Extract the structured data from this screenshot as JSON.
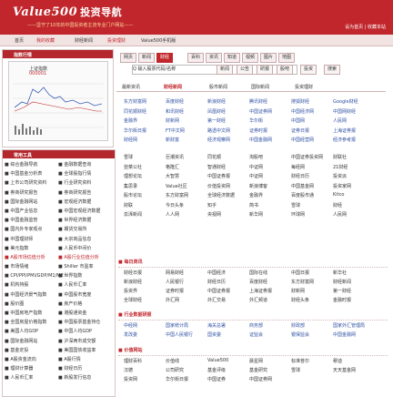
{
  "header": {
    "logo": "Value500",
    "logo_cn": "投资导航",
    "slogan": "——坚守了10年的中国投资者主流专业门户网站——",
    "right": "设为首页 | 收藏本站"
  },
  "subnav": [
    "首页",
    "我的收藏",
    "财经新闻",
    "投资理财",
    "Value500手机版"
  ],
  "left": {
    "hot_title": "指数行情",
    "chart": {
      "title": "上证指数",
      "subtitle": "000001",
      "badge": "+"
    },
    "tree_title": "常用工具",
    "tree": [
      {
        "a": "■ 综合金融导航",
        "b": "■ 金融数据查询"
      },
      {
        "a": "■ 中国基金分析表",
        "b": "■ 全球股指行情"
      },
      {
        "a": "■ 上市公司研究资料",
        "b": "■ 行业研究资料"
      },
      {
        "a": "■ 券商研究报告",
        "b": "■ 券商研究报告"
      },
      {
        "a": "■ 国际金融网站",
        "b": "■ 宏观经济数据"
      },
      {
        "a": "■ 中国产业信息",
        "b": "■ 中国宏观经济数据"
      },
      {
        "a": "■ 中国金融监管",
        "b": "■ 世界经济数据"
      },
      {
        "a": "■ 国内外专家观点",
        "b": "■ 期货交易所"
      },
      {
        "a": "■ 中国理财师",
        "b": "■ 大宗商品信息"
      },
      {
        "a": "■ 美元指数",
        "b": "■ 人民币中间价"
      },
      {
        "a": "■ A股市场估值分析",
        "b": "■ A股行业估值分析",
        "red": true
      },
      {
        "a": "■ 市场情绪",
        "b": "■ Shiller 市盈率"
      },
      {
        "a": "■ CPI/PPI/PMI/GDP/M1/M2",
        "b": "■ 世界指数"
      },
      {
        "a": "■ 机构持股",
        "b": "■ 人民币汇率"
      },
      {
        "a": "■ 中国经济景气指数",
        "b": "■ 中国股市宽度"
      },
      {
        "a": "■ 股价图",
        "b": "■ 房产价格"
      },
      {
        "a": "■ 中国房地产指数",
        "b": "■ 港股通资金"
      },
      {
        "a": "■ 全国房屋价格指数",
        "b": "■ 中国股票基金持仓"
      },
      {
        "a": "■ 美国人均GDP",
        "b": "■ 中国人均GDP"
      },
      {
        "a": "■ 国际金融网站",
        "b": "■ 沪深两市成交额"
      },
      {
        "a": "■ 基金定投",
        "b": "■ 美国国债收益率"
      },
      {
        "a": "■ A股资金流向",
        "b": "■ A股行情"
      },
      {
        "a": "■ 理财计算器",
        "b": "■ 财经日历"
      },
      {
        "a": "■ 人民币汇率",
        "b": "■ 新股发行信息"
      }
    ]
  },
  "tabs": [
    "网页",
    "新闻",
    "财经",
    "百科",
    "资讯",
    "知道",
    "视频",
    "图片",
    "地图"
  ],
  "search": {
    "placeholder": "Q 输入股票代码/名称",
    "buttons": [
      "新闻",
      "公告",
      "研报",
      "股吧",
      "投资",
      "搜索"
    ]
  },
  "news_tabs": [
    "最新资讯",
    "财经新闻",
    "股市新闻",
    "国际新闻",
    "投资理财"
  ],
  "rows1": [
    [
      "东方财富网",
      "百度财经",
      "新浪财经",
      "腾讯财经",
      "搜狐财经",
      "Google财经"
    ],
    [
      "同花顺财经",
      "和讯财经",
      "凤凰财经",
      "中国证券网",
      "中国经济网",
      "中国网财经"
    ],
    [
      "金融界",
      "财新网",
      "第一财经",
      "华尔街",
      "中国网",
      "人民网"
    ],
    [
      "华尔街日报",
      "FT中文网",
      "路透中文网",
      "证券时报",
      "证券日报",
      "上海证券报"
    ],
    [
      "财经网",
      "新财富",
      "经济观察网",
      "中国金融网",
      "中国经营网",
      "经济参考报"
    ]
  ],
  "rows2": [
    [
      "雪球",
      "巨潮资讯",
      "同花顺",
      "淘股吧",
      "中国证券投资网",
      "财联社"
    ],
    [
      "韭菜公社",
      "格隆汇",
      "智通财经",
      "中证网",
      "每经网",
      "21财经"
    ],
    [
      "理想论坛",
      "大智慧",
      "中国证券报",
      "中证网",
      "财经日历",
      "投资派"
    ],
    [
      "集思录",
      "Value社区",
      "价值投资网",
      "新浪博客",
      "中国基金网",
      "投资家网"
    ],
    [
      "股市论坛",
      "东方财富网",
      "全球经济数据",
      "金融界",
      "百度股市通",
      "Kitco"
    ],
    [
      "财联",
      "今日头条",
      "知乎",
      "简书",
      "雪球",
      "财经"
    ],
    [
      "澎湃新闻",
      "人人网",
      "央视网",
      "新华网",
      "环球网",
      "人民网"
    ]
  ],
  "sec1": "每日资讯",
  "rows3": [
    [
      "财经日报",
      "网易财经",
      "中国经济",
      "国际在线",
      "中国日报",
      "新华社"
    ],
    [
      "新浪财经",
      "人民银行",
      "财经日历",
      "百度财经",
      "东方财富网",
      "财经新闻"
    ],
    [
      "投资界",
      "证券时报",
      "中国证券报",
      "上海证券报",
      "财新网",
      "第一财经"
    ],
    [
      "全球财经",
      "外汇网",
      "外汇交易",
      "外汇频道",
      "财经头条",
      "金融时报"
    ]
  ],
  "sec2": "行业数据研报",
  "rows4": [
    [
      "中经网",
      "国家统计局",
      "海关总署",
      "商务部",
      "财政部",
      "国家外汇管理局"
    ],
    [
      "发改委",
      "中国人民银行",
      "国资委",
      "证监会",
      "银保监会",
      "中国金融网"
    ]
  ],
  "sec3": "价值网站",
  "rows5": [
    [
      "理财百科",
      "价值线",
      "Value500",
      "晨星网",
      "标准普尔",
      "穆迪"
    ],
    [
      "汉德",
      "公司研究",
      "基金评级",
      "基金研究",
      "雪球",
      "天天基金网"
    ],
    [
      "投资网",
      "华尔街日报",
      "中国证券",
      "中国证券网",
      "",
      ""
    ]
  ]
}
